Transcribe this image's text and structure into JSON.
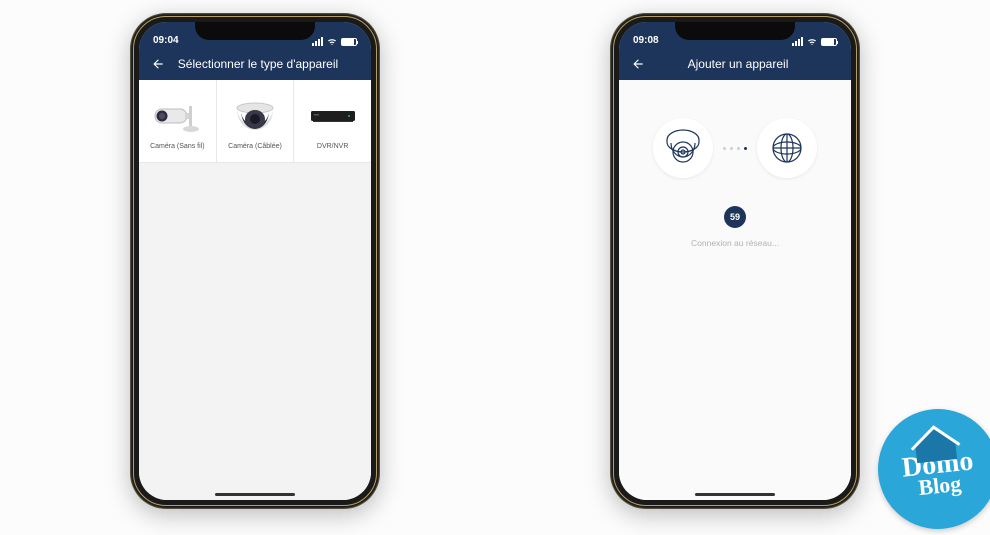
{
  "phone1": {
    "status_time": "09:04",
    "nav_title": "Sélectionner le type d'appareil",
    "tiles": [
      {
        "label": "Caméra (Sans fil)"
      },
      {
        "label": "Caméra (Câblée)"
      },
      {
        "label": "DVR/NVR"
      }
    ]
  },
  "phone2": {
    "status_time": "09:08",
    "nav_title": "Ajouter un appareil",
    "countdown": "59",
    "status_text": "Connexion au réseau..."
  },
  "colors": {
    "brand_navy": "#1d355a",
    "watermark_blue": "#2aa6d8"
  },
  "watermark": {
    "line1": "Domo",
    "line2": "Blog"
  }
}
